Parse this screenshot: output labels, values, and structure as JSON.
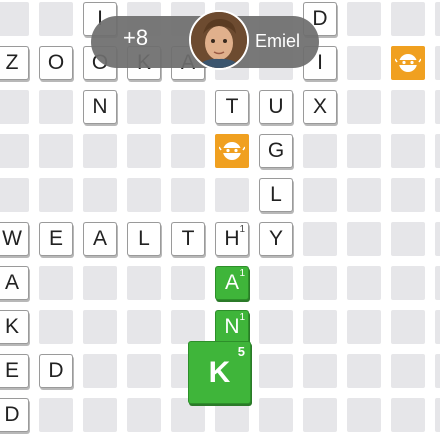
{
  "player": {
    "score_delta": "+8",
    "name": "Emiel"
  },
  "board": {
    "tiles": [
      {
        "letter": "I",
        "row": 0,
        "col": 2
      },
      {
        "letter": "D",
        "row": 0,
        "col": 7
      },
      {
        "letter": "Z",
        "row": 1,
        "col": 0
      },
      {
        "letter": "O",
        "row": 1,
        "col": 1
      },
      {
        "letter": "O",
        "row": 1,
        "col": 2
      },
      {
        "letter": "K",
        "row": 1,
        "col": 3
      },
      {
        "letter": "A",
        "row": 1,
        "col": 4
      },
      {
        "letter": "I",
        "row": 1,
        "col": 7
      },
      {
        "letter": "N",
        "row": 2,
        "col": 2
      },
      {
        "letter": "T",
        "row": 2,
        "col": 5
      },
      {
        "letter": "U",
        "row": 2,
        "col": 6
      },
      {
        "letter": "X",
        "row": 2,
        "col": 7
      },
      {
        "letter": "G",
        "row": 3,
        "col": 6
      },
      {
        "letter": "L",
        "row": 4,
        "col": 6
      },
      {
        "letter": "W",
        "row": 5,
        "col": 0
      },
      {
        "letter": "E",
        "row": 5,
        "col": 1
      },
      {
        "letter": "A",
        "row": 5,
        "col": 2
      },
      {
        "letter": "L",
        "row": 5,
        "col": 3
      },
      {
        "letter": "T",
        "row": 5,
        "col": 4
      },
      {
        "letter": "H",
        "row": 5,
        "col": 5,
        "points": "1"
      },
      {
        "letter": "Y",
        "row": 5,
        "col": 6
      },
      {
        "letter": "A",
        "row": 6,
        "col": 0
      },
      {
        "letter": "K",
        "row": 7,
        "col": 0
      },
      {
        "letter": "E",
        "row": 8,
        "col": 0
      },
      {
        "letter": "D",
        "row": 8,
        "col": 1
      },
      {
        "letter": "D",
        "row": 9,
        "col": 0
      }
    ],
    "new_tiles": [
      {
        "letter": "A",
        "row": 6,
        "col": 5,
        "points": "1"
      },
      {
        "letter": "N",
        "row": 7,
        "col": 5,
        "points": "1"
      }
    ],
    "active_tile": {
      "letter": "K",
      "points": "5"
    },
    "bonus_squares": [
      {
        "row": 1,
        "col": 9,
        "icon": "masked-bandit-icon"
      },
      {
        "row": 3,
        "col": 5,
        "icon": "masked-bandit-icon"
      }
    ],
    "colors": {
      "cell": "#e6e6e9",
      "new_tile": "#3fb53a",
      "bonus": "#f0a020"
    }
  }
}
